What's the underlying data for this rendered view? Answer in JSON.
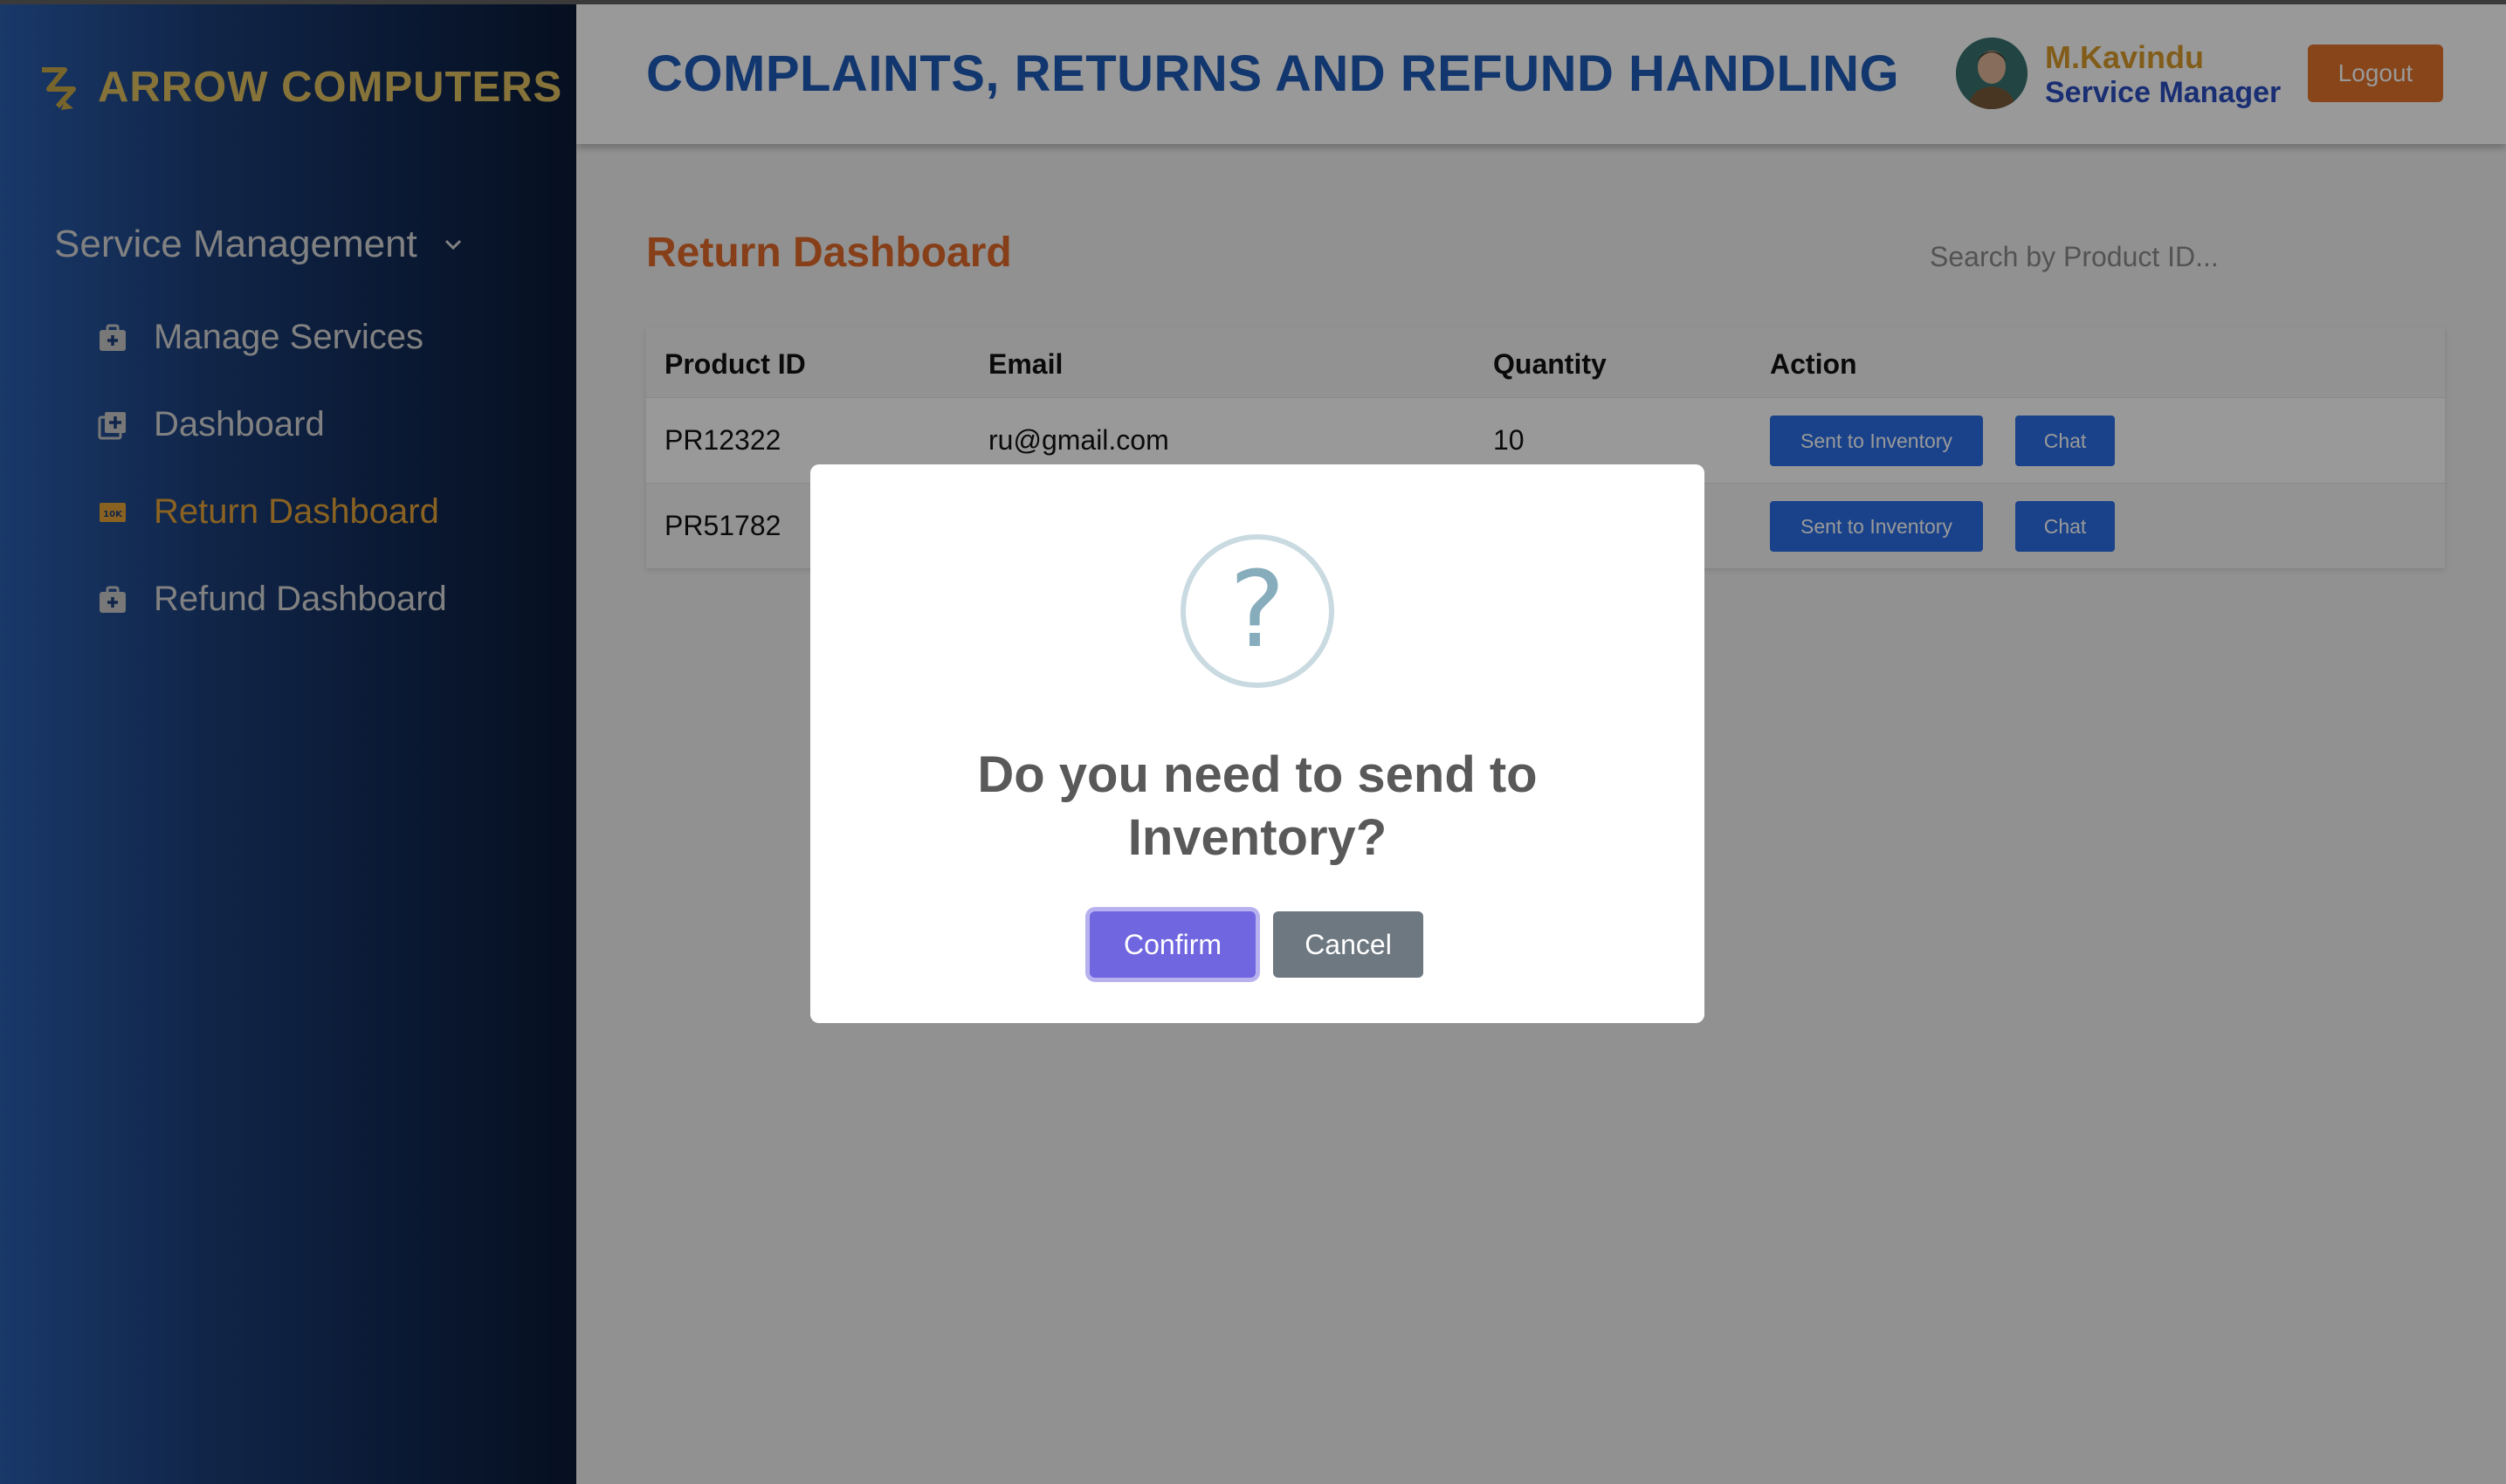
{
  "brand": {
    "name": "ARROW COMPUTERS"
  },
  "sidebar": {
    "section_label": "Service Management",
    "items": [
      {
        "label": "Manage Services",
        "icon": "briefcase-plus-icon"
      },
      {
        "label": "Dashboard",
        "icon": "add-box-icon"
      },
      {
        "label": "Return Dashboard",
        "icon": "ticket-icon",
        "active": true
      },
      {
        "label": "Refund Dashboard",
        "icon": "briefcase-plus-icon"
      }
    ]
  },
  "header": {
    "title": "COMPLAINTS, RETURNS AND REFUND HANDLING",
    "user_name": "M.Kavindu",
    "user_role": "Service Manager",
    "logout_label": "Logout"
  },
  "main": {
    "page_title": "Return Dashboard",
    "search_placeholder": "Search by Product ID...",
    "columns": [
      "Product ID",
      "Email",
      "Quantity",
      "Action"
    ],
    "rows": [
      {
        "product_id": "PR12322",
        "email": "ru@gmail.com",
        "quantity": "10",
        "action_primary": "Sent to Inventory",
        "action_secondary": "Chat"
      },
      {
        "product_id": "PR51782",
        "email": "",
        "quantity": "",
        "action_primary": "Sent to Inventory",
        "action_secondary": "Chat"
      }
    ]
  },
  "modal": {
    "icon": "question-icon",
    "icon_glyph": "?",
    "title": "Do you need to send to Inventory?",
    "confirm_label": "Confirm",
    "cancel_label": "Cancel"
  },
  "colors": {
    "brand_gold": "#e0c060",
    "accent_orange": "#e06a28",
    "primary_blue": "#2a6fe6",
    "confirm_purple": "#7066e0",
    "cancel_gray": "#6e7881"
  }
}
